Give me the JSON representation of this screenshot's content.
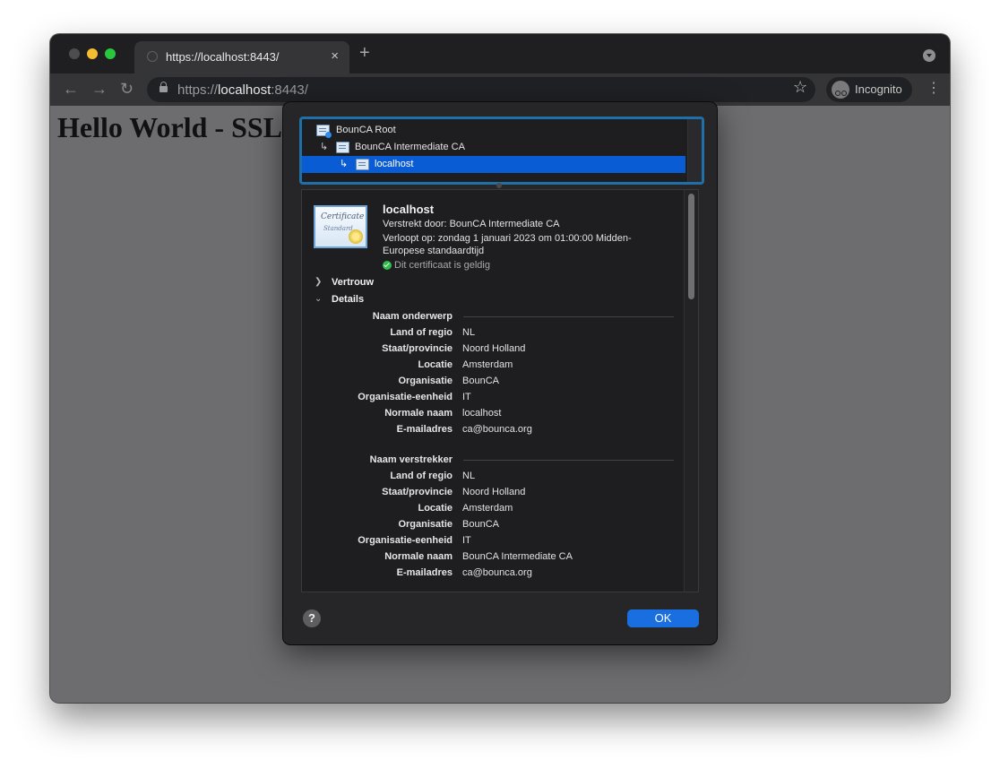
{
  "browser": {
    "tab_title": "https://localhost:8443/",
    "tab_close": "×",
    "new_tab": "+",
    "url_scheme": "https://",
    "url_host": "localhost",
    "url_rest": ":8443/",
    "incognito_label": "Incognito"
  },
  "page": {
    "heading": "Hello World - SSL certificate"
  },
  "chain": [
    {
      "label": "BounCA Root"
    },
    {
      "label": "BounCA Intermediate CA"
    },
    {
      "label": "localhost"
    }
  ],
  "cert_icon_text": {
    "line1": "Certificate",
    "line2": "Standard"
  },
  "certificate": {
    "name": "localhost",
    "issued_by": "Verstrekt door: BounCA Intermediate CA",
    "expires_line1": "Verloopt op: zondag 1 januari 2023 om 01:00:00 Midden-",
    "expires_line2": "Europese standaardtijd",
    "valid": "Dit certificaat is geldig"
  },
  "sections": {
    "trust": "Vertrouw",
    "details": "Details"
  },
  "subject": {
    "title": "Naam onderwerp",
    "rows": [
      {
        "label": "Land of regio",
        "value": "NL"
      },
      {
        "label": "Staat/provincie",
        "value": "Noord Holland"
      },
      {
        "label": "Locatie",
        "value": "Amsterdam"
      },
      {
        "label": "Organisatie",
        "value": "BounCA"
      },
      {
        "label": "Organisatie-eenheid",
        "value": "IT"
      },
      {
        "label": "Normale naam",
        "value": "localhost"
      },
      {
        "label": "E-mailadres",
        "value": "ca@bounca.org"
      }
    ]
  },
  "issuer": {
    "title": "Naam verstrekker",
    "rows": [
      {
        "label": "Land of regio",
        "value": "NL"
      },
      {
        "label": "Staat/provincie",
        "value": "Noord Holland"
      },
      {
        "label": "Locatie",
        "value": "Amsterdam"
      },
      {
        "label": "Organisatie",
        "value": "BounCA"
      },
      {
        "label": "Organisatie-eenheid",
        "value": "IT"
      },
      {
        "label": "Normale naam",
        "value": "BounCA Intermediate CA"
      },
      {
        "label": "E-mailadres",
        "value": "ca@bounca.org"
      }
    ]
  },
  "buttons": {
    "help": "?",
    "ok": "OK"
  },
  "colors": {
    "accent": "#0a5cd4",
    "ok_button": "#1a6fe0",
    "valid_green": "#2fbd4c"
  }
}
